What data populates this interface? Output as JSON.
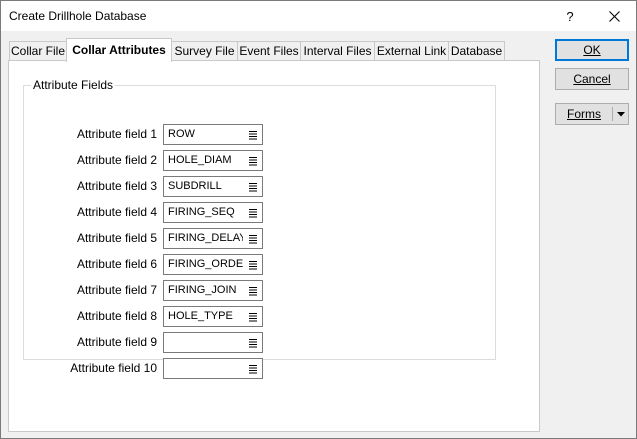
{
  "window": {
    "title": "Create Drillhole Database",
    "help_label": "?"
  },
  "tabs": [
    {
      "label": "Collar File",
      "active": false
    },
    {
      "label": "Collar Attributes",
      "active": true
    },
    {
      "label": "Survey File",
      "active": false
    },
    {
      "label": "Event Files",
      "active": false
    },
    {
      "label": "Interval Files",
      "active": false
    },
    {
      "label": "External Link",
      "active": false
    },
    {
      "label": "Database",
      "active": false
    }
  ],
  "attribute_fields": {
    "group_label": "Attribute Fields",
    "fields": [
      {
        "label": "Attribute field 1",
        "value": "ROW"
      },
      {
        "label": "Attribute field 2",
        "value": "HOLE_DIAM"
      },
      {
        "label": "Attribute field 3",
        "value": "SUBDRILL"
      },
      {
        "label": "Attribute field 4",
        "value": "FIRING_SEQ"
      },
      {
        "label": "Attribute field 5",
        "value": "FIRING_DELAY"
      },
      {
        "label": "Attribute field 6",
        "value": "FIRING_ORDER"
      },
      {
        "label": "Attribute field 7",
        "value": "FIRING_JOIN"
      },
      {
        "label": "Attribute field 8",
        "value": "HOLE_TYPE"
      },
      {
        "label": "Attribute field 9",
        "value": ""
      },
      {
        "label": "Attribute field 10",
        "value": ""
      }
    ]
  },
  "buttons": {
    "ok_label": "OK",
    "cancel_label": "Cancel",
    "forms_label": "Forms"
  },
  "colors": {
    "window_bg": "#f0f0f0",
    "panel_bg": "#ffffff",
    "default_button_border": "#0078d7"
  },
  "icons": {
    "close": "close-icon",
    "field_list": "list-icon",
    "forms_dropdown": "caret-down-icon"
  }
}
